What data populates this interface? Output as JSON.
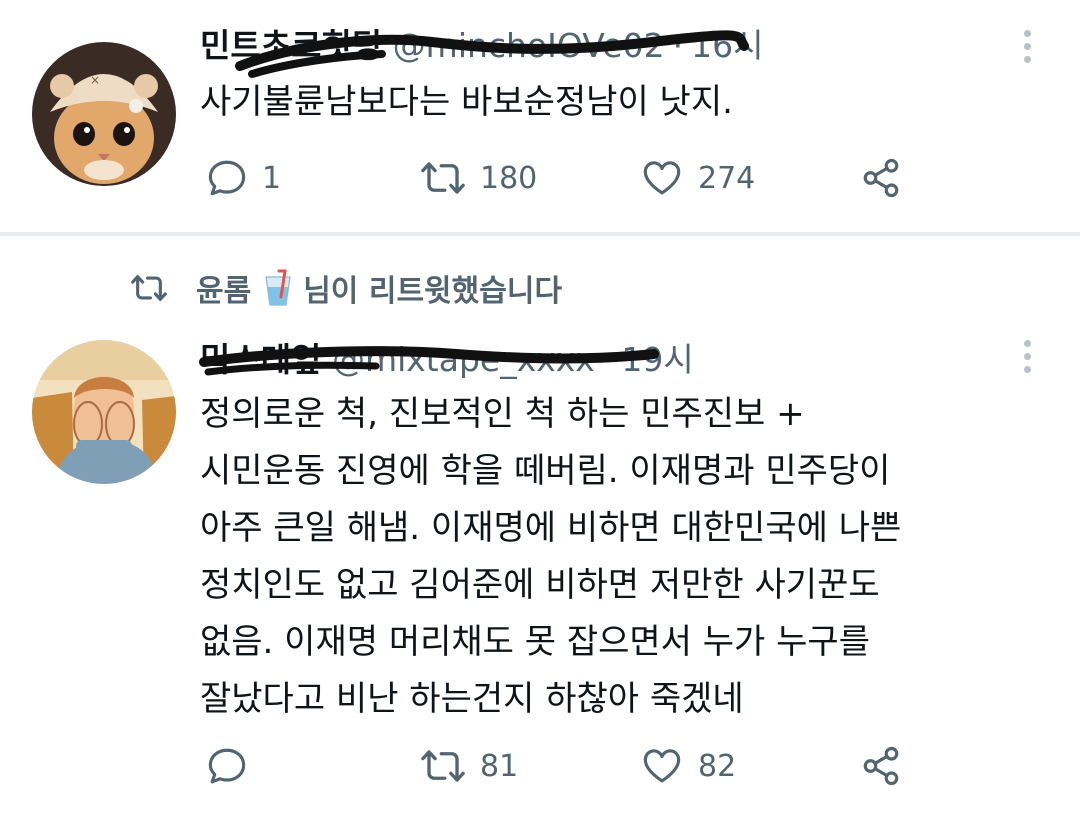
{
  "tweets": [
    {
      "name": "민트초코힛팅",
      "handle": "@minchoIOVe02",
      "separator": "·",
      "time": "16시",
      "lines": [
        "사기불륜남보다는 바보순정남이 낫지."
      ],
      "counts": {
        "reply": "1",
        "retweet": "180",
        "like": "274"
      },
      "icons": [
        "more-icon",
        "reply-icon",
        "retweet-icon",
        "like-icon",
        "share-icon"
      ]
    },
    {
      "retweet_banner": {
        "user": "윤롬",
        "emoji": "drink-cup-emoji",
        "text": "님이 리트윗했습니다"
      },
      "name": "믹스테잎",
      "handle": "@mixtape_xxxx",
      "separator": "·",
      "time": "19시",
      "lines": [
        "정의로운 척, 진보적인 척 하는 민주진보 +",
        "시민운동 진영에 학을 떼버림. 이재명과 민주당이",
        "아주 큰일 해냄. 이재명에 비하면 대한민국에 나쁜",
        "정치인도 없고 김어준에 비하면 저만한 사기꾼도",
        "없음. 이재명 머리채도 못 잡으면서 누가 누구를",
        "잘났다고 비난 하는건지 하찮아 죽겠네"
      ],
      "counts": {
        "reply": "",
        "retweet": "81",
        "like": "82"
      },
      "icons": [
        "more-icon",
        "reply-icon",
        "retweet-icon",
        "like-icon",
        "share-icon"
      ]
    }
  ],
  "colors": {
    "text": "#0f1419",
    "secondary": "#536471",
    "divider": "#e8ecef",
    "redaction": "#111111"
  }
}
